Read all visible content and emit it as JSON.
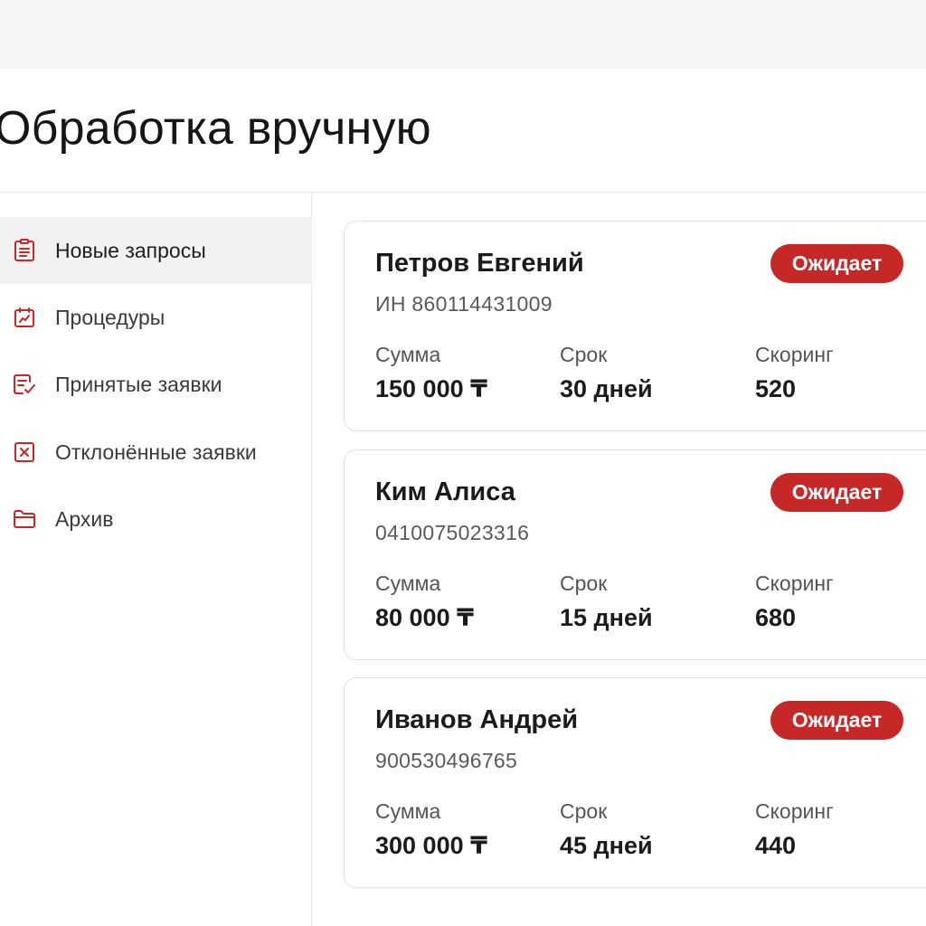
{
  "page": {
    "title": "Обработка вручную"
  },
  "colors": {
    "accent": "#c62828",
    "topbar": "#f6f6f6",
    "active_nav": "#f2f2f2"
  },
  "sidebar": {
    "items": [
      {
        "label": "Новые запросы",
        "icon": "clipboard-list-icon",
        "active": true
      },
      {
        "label": "Процедуры",
        "icon": "calendar-chart-icon",
        "active": false
      },
      {
        "label": "Принятые заявки",
        "icon": "document-check-icon",
        "active": false
      },
      {
        "label": "Отклонённые заявки",
        "icon": "x-box-icon",
        "active": false
      },
      {
        "label": "Архив",
        "icon": "folder-icon",
        "active": false
      }
    ]
  },
  "requests": [
    {
      "name": "Петров Евгений",
      "id": "ИН 860114431009",
      "status": "Ожидает",
      "amount_label": "Сумма",
      "amount": "150 000 ₸",
      "term_label": "Срок",
      "term": "30 дней",
      "score_label": "Скоринг",
      "score": "520"
    },
    {
      "name": "Ким Алиса",
      "id": "0410075023316",
      "status": "Ожидает",
      "amount_label": "Сумма",
      "amount": "80 000 ₸",
      "term_label": "Срок",
      "term": "15 дней",
      "score_label": "Скоринг",
      "score": "680"
    },
    {
      "name": "Иванов Андрей",
      "id": "900530496765",
      "status": "Ожидает",
      "amount_label": "Сумма",
      "amount": "300 000 ₸",
      "term_label": "Срок",
      "term": "45 дней",
      "score_label": "Скоринг",
      "score": "440"
    }
  ]
}
